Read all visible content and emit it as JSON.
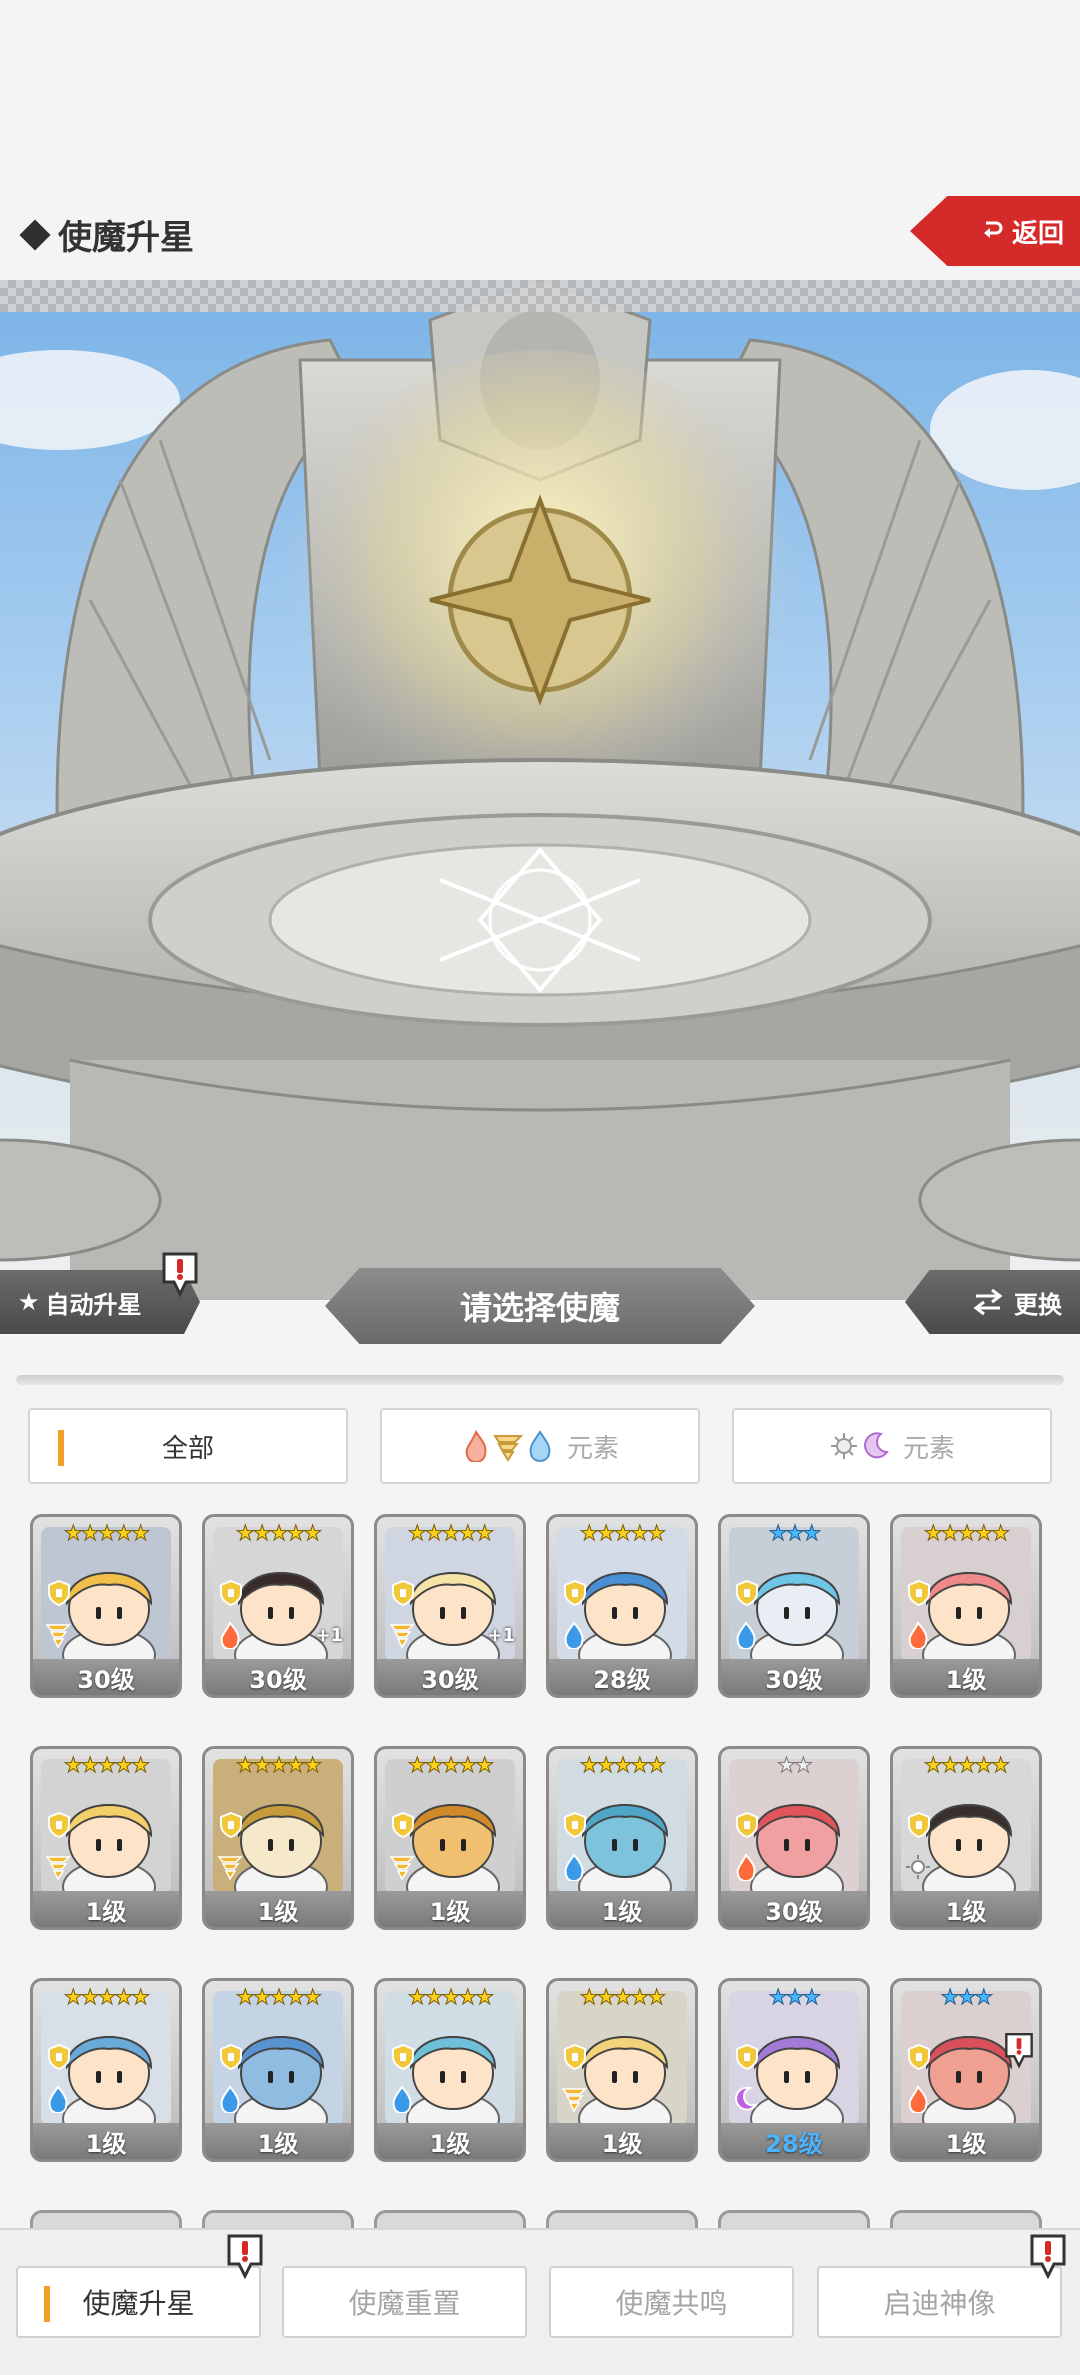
{
  "header": {
    "title": "使魔升星",
    "back_label": "返回"
  },
  "actions": {
    "auto_star_label": "自动升星",
    "select_prompt": "请选择使魔",
    "swap_label": "更换"
  },
  "filters": {
    "all_label": "全部",
    "element_label_1": "元素",
    "element_label_2": "元素"
  },
  "cards": [
    {
      "level": "30级",
      "stars": 5,
      "star_color": "gold",
      "element": "wind",
      "plus": "",
      "hair": "#f2c04a",
      "skin": "#fde3c8",
      "bg": "#bfc6d3"
    },
    {
      "level": "30级",
      "stars": 5,
      "star_color": "gold",
      "element": "fire",
      "plus": "+1",
      "hair": "#3a2b2b",
      "skin": "#fde3c8",
      "bg": "#d6d6d6"
    },
    {
      "level": "30级",
      "stars": 5,
      "star_color": "gold",
      "element": "wind",
      "plus": "+1",
      "hair": "#f5e3a8",
      "skin": "#fde3c8",
      "bg": "#cfd6e2"
    },
    {
      "level": "28级",
      "stars": 5,
      "star_color": "gold",
      "element": "water",
      "plus": "",
      "hair": "#4a8fd6",
      "skin": "#fde3c8",
      "bg": "#d2dbe6"
    },
    {
      "level": "30级",
      "stars": 3,
      "star_color": "blue",
      "element": "water",
      "plus": "",
      "hair": "#6ec6e8",
      "skin": "#e8eef3",
      "bg": "#c6cfd8"
    },
    {
      "level": "1级",
      "stars": 5,
      "star_color": "gold",
      "element": "fire",
      "plus": "",
      "hair": "#f08a8a",
      "skin": "#fde3c8",
      "bg": "#d8d0d0"
    },
    {
      "level": "1级",
      "stars": 5,
      "star_color": "gold",
      "element": "wind",
      "plus": "",
      "hair": "#f2cf6a",
      "skin": "#fde3c8",
      "bg": "#d3d3d3"
    },
    {
      "level": "1级",
      "stars": 5,
      "star_color": "gold",
      "element": "wind",
      "plus": "",
      "hair": "#c79a3a",
      "skin": "#f6e9c9",
      "bg": "#c9b07a"
    },
    {
      "level": "1级",
      "stars": 5,
      "star_color": "gold",
      "element": "wind",
      "plus": "",
      "hair": "#d18a2a",
      "skin": "#f0c070",
      "bg": "#cfcfcf"
    },
    {
      "level": "1级",
      "stars": 5,
      "star_color": "gold",
      "element": "water",
      "plus": "",
      "hair": "#4fa6c8",
      "skin": "#7cc3db",
      "bg": "#d0dbe2"
    },
    {
      "level": "30级",
      "stars": 2,
      "star_color": "silver",
      "element": "fire",
      "plus": "",
      "hair": "#e0545a",
      "skin": "#f0a0a0",
      "bg": "#dcd0d0"
    },
    {
      "level": "1级",
      "stars": 5,
      "star_color": "gold",
      "element": "light",
      "plus": "",
      "hair": "#3a2f2f",
      "skin": "#fde3c8",
      "bg": "#d8d8d8"
    },
    {
      "level": "1级",
      "stars": 5,
      "star_color": "gold",
      "element": "water",
      "plus": "",
      "hair": "#6aaad8",
      "skin": "#fde3c8",
      "bg": "#d8dfe6"
    },
    {
      "level": "1级",
      "stars": 5,
      "star_color": "gold",
      "element": "water",
      "plus": "",
      "hair": "#5a94d0",
      "skin": "#8fbce0",
      "bg": "#c4d4e4"
    },
    {
      "level": "1级",
      "stars": 5,
      "star_color": "gold",
      "element": "water",
      "plus": "",
      "hair": "#6ec0d8",
      "skin": "#fde3c8",
      "bg": "#d0dde4"
    },
    {
      "level": "1级",
      "stars": 5,
      "star_color": "gold",
      "element": "wind",
      "plus": "",
      "hair": "#f2d27a",
      "skin": "#fde3c8",
      "bg": "#d8d4c8"
    },
    {
      "level": "28级",
      "stars": 3,
      "star_color": "blue",
      "element": "dark",
      "plus": "",
      "hair": "#a47ad8",
      "skin": "#fde3c8",
      "bg": "#d8d4e4",
      "highlight": true
    },
    {
      "level": "1级",
      "stars": 3,
      "star_color": "blue",
      "element": "fire",
      "plus": "",
      "hair": "#d8505a",
      "skin": "#f0a090",
      "bg": "#dccfcf"
    }
  ],
  "bottom_nav": {
    "tab1": "使魔升星",
    "tab2": "使魔重置",
    "tab3": "使魔共鸣",
    "tab4": "启迪神像"
  },
  "colors": {
    "accent": "#f0a024",
    "back_red": "#d52a2a",
    "star_gold": "#ffd21a",
    "star_blue": "#47b8ff"
  }
}
